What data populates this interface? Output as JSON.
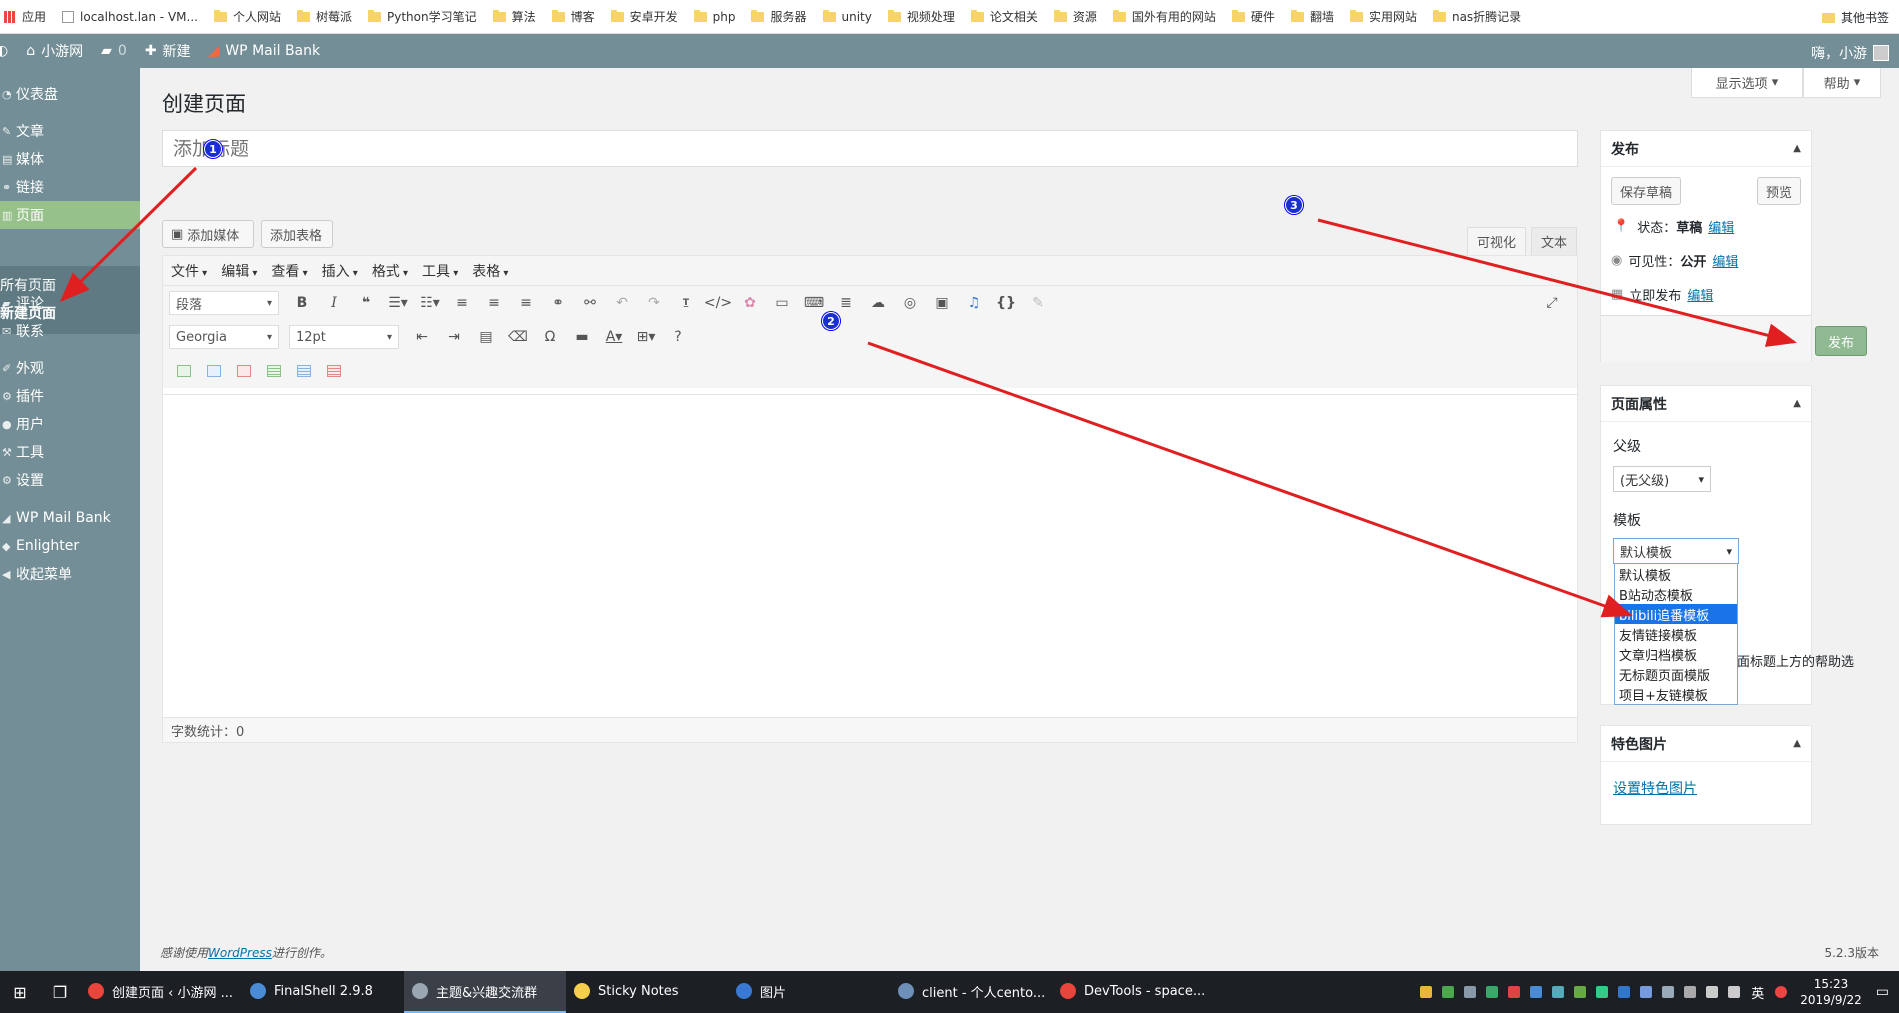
{
  "bookmarks": {
    "items": [
      {
        "label": "应用",
        "kind": "apps"
      },
      {
        "label": "localhost.lan - VM...",
        "kind": "page"
      },
      {
        "label": "个人网站",
        "kind": "folder"
      },
      {
        "label": "树莓派",
        "kind": "folder"
      },
      {
        "label": "Python学习笔记",
        "kind": "folder"
      },
      {
        "label": "算法",
        "kind": "folder"
      },
      {
        "label": "博客",
        "kind": "folder"
      },
      {
        "label": "安卓开发",
        "kind": "folder"
      },
      {
        "label": "php",
        "kind": "folder"
      },
      {
        "label": "服务器",
        "kind": "folder"
      },
      {
        "label": "unity",
        "kind": "folder"
      },
      {
        "label": "视频处理",
        "kind": "folder"
      },
      {
        "label": "论文相关",
        "kind": "folder"
      },
      {
        "label": "资源",
        "kind": "folder"
      },
      {
        "label": "国外有用的网站",
        "kind": "folder"
      },
      {
        "label": "硬件",
        "kind": "folder"
      },
      {
        "label": "翻墙",
        "kind": "folder"
      },
      {
        "label": "实用网站",
        "kind": "folder"
      },
      {
        "label": "nas折腾记录",
        "kind": "folder"
      }
    ],
    "other": "其他书签"
  },
  "adminbar": {
    "site_name": "小游网",
    "comments_count": "0",
    "new_label": "新建",
    "plugin_label": "WP Mail Bank",
    "greeting": "嗨，小游"
  },
  "sidebar": {
    "items": [
      {
        "label": "仪表盘",
        "icon": "dashboard-icon"
      },
      {
        "label": "文章",
        "icon": "pin-icon"
      },
      {
        "label": "媒体",
        "icon": "media-icon"
      },
      {
        "label": "链接",
        "icon": "link-icon"
      },
      {
        "label": "页面",
        "icon": "page-icon"
      },
      {
        "label": "评论",
        "icon": "comment-icon"
      },
      {
        "label": "联系",
        "icon": "mail-icon"
      },
      {
        "label": "外观",
        "icon": "brush-icon"
      },
      {
        "label": "插件",
        "icon": "plugin-icon"
      },
      {
        "label": "用户",
        "icon": "user-icon"
      },
      {
        "label": "工具",
        "icon": "wrench-icon"
      },
      {
        "label": "设置",
        "icon": "settings-icon"
      },
      {
        "label": "WP Mail Bank",
        "icon": "mailbank-icon"
      },
      {
        "label": "Enlighter",
        "icon": "enlighter-icon"
      },
      {
        "label": "收起菜单",
        "icon": "collapse-icon"
      }
    ],
    "submenu": [
      "所有页面",
      "新建页面"
    ]
  },
  "screen_options": "显示选项",
  "help": "帮助",
  "page_title": "创建页面",
  "title_placeholder": "添加标题",
  "media_btn": "添加媒体",
  "form_btn": "添加表格",
  "tab_visual": "可视化",
  "tab_text": "文本",
  "editor": {
    "menus": [
      "文件",
      "编辑",
      "查看",
      "插入",
      "格式",
      "工具",
      "表格"
    ],
    "format_select": "段落",
    "font_select": "Georgia",
    "size_select": "12pt",
    "word_count": "字数统计：0"
  },
  "publish": {
    "title": "发布",
    "save_draft": "保存草稿",
    "preview": "预览",
    "status_label": "状态：",
    "status_value": "草稿",
    "visibility_label": "可见性：",
    "visibility_value": "公开",
    "schedule_label": "立即发布",
    "edit": "编辑",
    "publish_btn": "发布"
  },
  "attributes": {
    "title": "页面属性",
    "parent_label": "父级",
    "parent_value": "(无父级)",
    "template_label": "模板",
    "template_value": "默认模板",
    "template_options": [
      "默认模板",
      "B站动态模板",
      "bilibili追番模板",
      "友情链接模板",
      "文章归档模板",
      "无标题页面模版",
      "项目+友链模板"
    ],
    "selected_index": 2,
    "help_text": "面标题上方的帮助选"
  },
  "featured": {
    "title": "特色图片",
    "link": "设置特色图片"
  },
  "footer": {
    "thanks_prefix": "感谢使用",
    "thanks_link": "WordPress",
    "thanks_suffix": "进行创作。",
    "version": "5.2.3版本"
  },
  "taskbar": {
    "tasks": [
      {
        "label": "创建页面 ‹ 小游网 ...",
        "color": "#e8453c"
      },
      {
        "label": "FinalShell 2.9.8",
        "color": "#4a8bd6"
      },
      {
        "label": "主题&兴趣交流群",
        "color": "#9aa6b2"
      },
      {
        "label": "Sticky Notes",
        "color": "#f6d04d"
      },
      {
        "label": "图片",
        "color": "#3a78d4"
      },
      {
        "label": "client - 个人cento...",
        "color": "#6e8fb8"
      },
      {
        "label": "DevTools - space...",
        "color": "#e8453c"
      }
    ],
    "ime": "英",
    "time": "15:23",
    "date": "2019/9/22"
  },
  "annotations": [
    "1",
    "2",
    "3"
  ],
  "colors": {
    "admin": "#738e96",
    "current": "#96c18a",
    "arrow": "#e02020",
    "badge": "#1a2fd1"
  }
}
